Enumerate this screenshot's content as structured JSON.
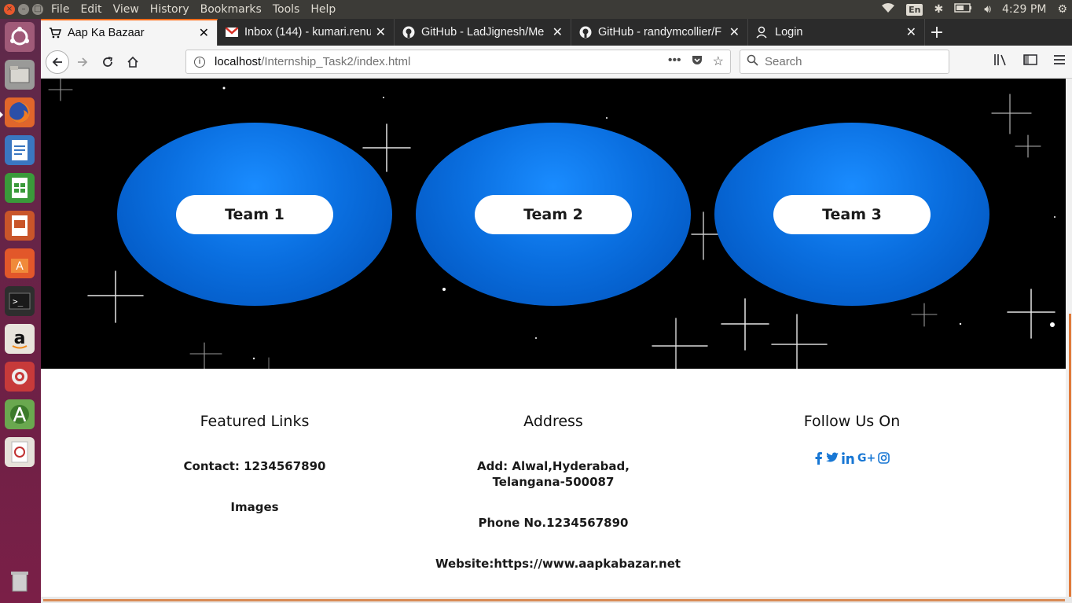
{
  "os_panel": {
    "menu": [
      "File",
      "Edit",
      "View",
      "History",
      "Bookmarks",
      "Tools",
      "Help"
    ],
    "keyboard_layout": "En",
    "time": "4:29 PM"
  },
  "browser": {
    "tabs": [
      {
        "title": "Aap Ka Bazaar",
        "icon": "cart-icon",
        "active": true
      },
      {
        "title": "Inbox (144) - kumari.renu",
        "icon": "gmail-icon",
        "active": false
      },
      {
        "title": "GitHub - LadJignesh/Me",
        "icon": "github-icon",
        "active": false
      },
      {
        "title": "GitHub - randymcollier/F",
        "icon": "github-icon",
        "active": false
      },
      {
        "title": "Login",
        "icon": "user-icon",
        "active": false
      }
    ],
    "url_host": "localhost",
    "url_path": "/Internship_Task2/index.html",
    "search_placeholder": "Search"
  },
  "page": {
    "teams": [
      "Team 1",
      "Team 2",
      "Team 3"
    ],
    "footer": {
      "featured": {
        "heading": "Featured Links",
        "contact": "Contact: 1234567890",
        "images": "Images"
      },
      "address": {
        "heading": "Address",
        "add_line1": "Add: Alwal,Hyderabad,",
        "add_line2": "Telangana-500087",
        "phone": "Phone No.1234567890",
        "website": "Website:https://www.aapkabazar.net"
      },
      "follow": {
        "heading": "Follow Us On",
        "icons": [
          "facebook-icon",
          "twitter-icon",
          "linkedin-icon",
          "google-plus-icon",
          "instagram-icon"
        ]
      }
    }
  },
  "colors": {
    "ellipse_blue": "#0a6fe0",
    "social_blue": "#1877d4",
    "firefox_accent": "#ff6d1a"
  }
}
